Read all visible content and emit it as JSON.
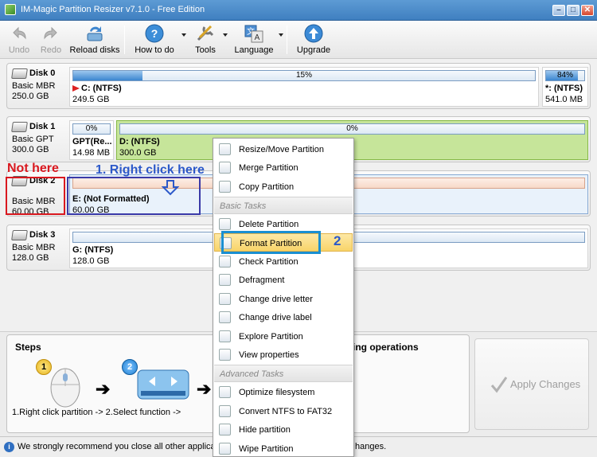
{
  "window": {
    "title": "IM-Magic Partition Resizer v7.1.0 - Free Edition"
  },
  "toolbar": {
    "undo": "Undo",
    "redo": "Redo",
    "reload": "Reload disks",
    "howto": "How to do",
    "tools": "Tools",
    "language": "Language",
    "upgrade": "Upgrade"
  },
  "disks": [
    {
      "name": "Disk 0",
      "type": "Basic MBR",
      "size": "250.0 GB",
      "partitions": [
        {
          "bar": "15%",
          "used": 0.15,
          "name": "C: (NTFS)",
          "size": "249.5 GB"
        },
        {
          "bar": "84%",
          "used": 0.84,
          "name": "*: (NTFS)",
          "size": "541.0 MB"
        }
      ]
    },
    {
      "name": "Disk 1",
      "type": "Basic GPT",
      "size": "300.0 GB",
      "partitions": [
        {
          "bar": "0%",
          "used": 0,
          "name": "GPT(Re...",
          "size": "14.98 MB"
        },
        {
          "bar": "0%",
          "used": 0,
          "name": "D: (NTFS)",
          "size": "300.0 GB"
        }
      ]
    },
    {
      "name": "Disk 2",
      "type": "Basic MBR",
      "size": "60.00 GB",
      "partitions": [
        {
          "bar": "",
          "used": 0,
          "name": "E: (Not Formatted)",
          "size": "60.00 GB"
        }
      ]
    },
    {
      "name": "Disk 3",
      "type": "Basic MBR",
      "size": "128.0 GB",
      "partitions": [
        {
          "bar": "",
          "used": 0,
          "name": "G: (NTFS)",
          "size": "128.0 GB"
        }
      ]
    }
  ],
  "annotations": {
    "not_here": "Not here",
    "right_click": "1. Right click here",
    "two": "2"
  },
  "context_menu": {
    "top_items": [
      "Resize/Move Partition",
      "Merge Partition",
      "Copy Partition"
    ],
    "basic_header": "Basic Tasks",
    "basic_items": [
      "Delete Partition",
      "Format Partition",
      "Check Partition",
      "Defragment",
      "Change drive letter",
      "Change drive label",
      "Explore Partition",
      "View properties"
    ],
    "advanced_header": "Advanced Tasks",
    "advanced_items": [
      "Optimize filesystem",
      "Convert NTFS to FAT32",
      "Hide partition",
      "Wipe Partition"
    ]
  },
  "steps": {
    "title": "Steps",
    "text": "1.Right click partition -> 2.Select function ->",
    "badge1": "1",
    "badge2": "2"
  },
  "pending": {
    "title_fragment": "ing operations"
  },
  "apply": {
    "label": "Apply Changes"
  },
  "status": {
    "left": "We strongly recommend you close all other applica",
    "right": "hanges."
  }
}
